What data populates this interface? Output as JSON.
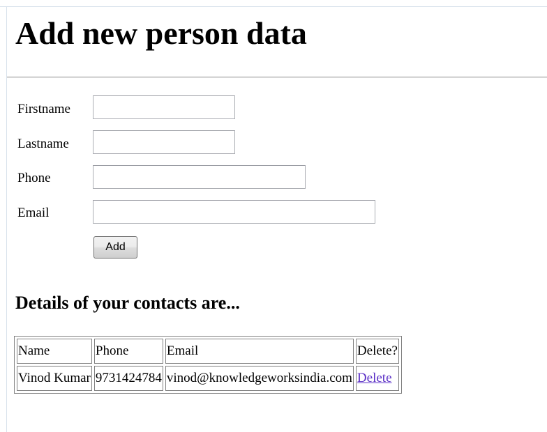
{
  "page": {
    "title": "Add new person data",
    "contacts_heading": "Details of your contacts are..."
  },
  "form": {
    "firstname": {
      "label": "Firstname",
      "value": "",
      "placeholder": ""
    },
    "lastname": {
      "label": "Lastname",
      "value": "",
      "placeholder": ""
    },
    "phone": {
      "label": "Phone",
      "value": "",
      "placeholder": ""
    },
    "email": {
      "label": "Email",
      "value": "",
      "placeholder": ""
    },
    "add_button_label": "Add"
  },
  "table": {
    "headers": {
      "name": "Name",
      "phone": "Phone",
      "email": "Email",
      "delete": "Delete?"
    },
    "rows": [
      {
        "name": "Vinod Kumar",
        "phone": "9731424784",
        "email": "vinod@knowledgeworksindia.com",
        "delete_label": "Delete"
      }
    ]
  },
  "colors": {
    "link": "#5a2ec6",
    "border": "#808080",
    "rule": "#a6a6a6"
  }
}
